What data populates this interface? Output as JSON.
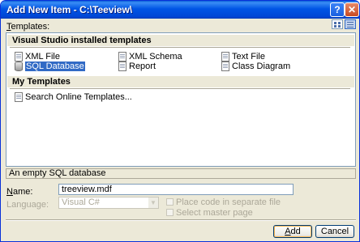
{
  "window": {
    "title": "Add New Item - C:\\Teeview\\"
  },
  "titlebar_buttons": {
    "help": "?",
    "close": "✕"
  },
  "templates": {
    "label": "Templates:",
    "label_underline": "T",
    "label_rest": "emplates:",
    "groups": [
      {
        "title": "Visual Studio installed templates"
      },
      {
        "title": "My Templates"
      }
    ],
    "installed_items": [
      {
        "label": "XML File",
        "icon": "xml-file-icon"
      },
      {
        "label": "SQL Database",
        "icon": "sql-database-icon",
        "selected": true
      },
      {
        "label": "XML Schema",
        "icon": "xml-schema-icon"
      },
      {
        "label": "Report",
        "icon": "report-icon"
      },
      {
        "label": "Text File",
        "icon": "text-file-icon"
      },
      {
        "label": "Class Diagram",
        "icon": "class-diagram-icon"
      }
    ],
    "my_items": [
      {
        "label": "Search Online Templates...",
        "icon": "search-online-icon"
      }
    ]
  },
  "description": "An empty SQL database",
  "form": {
    "name_label_ul": "N",
    "name_label_rest": "ame:",
    "name_value": "treeview.mdf",
    "language_label": "Language:",
    "language_value": "Visual C#",
    "checkbox_code_separate": "Place code in separate file",
    "checkbox_master_page": "Select master page"
  },
  "buttons": {
    "add": "Add",
    "add_ul": "A",
    "add_rest": "dd",
    "cancel": "Cancel"
  }
}
